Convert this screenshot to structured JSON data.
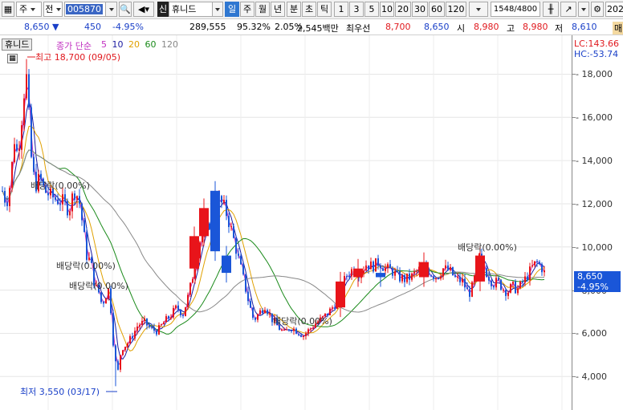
{
  "toolbar": {
    "market_type": "주",
    "prev_label": "전",
    "code": "005870",
    "stock_name_badge": "신",
    "stock_name": "휴니드",
    "periods": [
      "일",
      "주",
      "월",
      "년",
      "분",
      "초",
      "틱"
    ],
    "active_period": "일",
    "numbers": [
      "1",
      "3",
      "5",
      "10",
      "20",
      "30",
      "60",
      "120"
    ],
    "count": "1548",
    "total": "4800",
    "date_partial": "202"
  },
  "quote": {
    "price": "8,650",
    "change": "450",
    "change_pct": "-4.95%",
    "volume": "289,555",
    "vol_ratio": "95.32%",
    "turnover": "2.05%",
    "amount": "2,545백만",
    "best_label": "최우선",
    "best_ask": "8,700",
    "best_bid": "8,650",
    "open_label": "시",
    "open": "8,980",
    "high_label": "고",
    "high": "8,980",
    "low_label": "저",
    "low": "8,610",
    "tail": "매"
  },
  "legend": {
    "chart_name": "휴니드",
    "indicator": "종가 단순",
    "ma": [
      {
        "label": "5",
        "color": "#c02fc0"
      },
      {
        "label": "10",
        "color": "#1a1aa0"
      },
      {
        "label": "20",
        "color": "#e0a000"
      },
      {
        "label": "60",
        "color": "#1a8a1a"
      },
      {
        "label": "120",
        "color": "#888888"
      }
    ]
  },
  "right_labels": {
    "lc": "LC:143.66",
    "hc": "HC:-53.74",
    "price_badge": "8,650",
    "pct_badge": "-4.95%"
  },
  "annotations": {
    "max": "최고 18,700 (09/05)",
    "min": "최저 3,550 (03/17)",
    "dividends": [
      "배당락(0.00%)",
      "배당락(0.00%)",
      "배당락(0.00%)",
      "배당락(0.00%)",
      "배당락(0.00%)"
    ]
  },
  "colors": {
    "up": "#e8141a",
    "down": "#1a56d8",
    "axis": "#888888"
  },
  "chart_data": {
    "type": "candlestick",
    "y_ticks": [
      4000,
      6000,
      8000,
      10000,
      12000,
      14000,
      16000,
      18000
    ],
    "y_tick_labels": [
      "4,000",
      "6,000",
      "8,000",
      "10,000",
      "12,000",
      "14,000",
      "16,000",
      "18,000"
    ],
    "ylim": [
      2450,
      19800
    ],
    "last_price": 8650,
    "last_change_pct": -4.95,
    "all_time_high": 18700,
    "all_time_low": 3550
  }
}
